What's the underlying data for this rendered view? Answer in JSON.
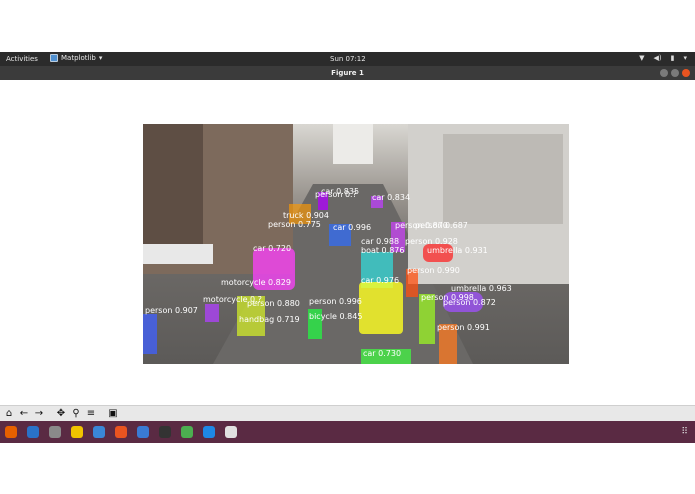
{
  "topbar": {
    "activities": "Activities",
    "app_name": "Matplotlib",
    "app_arrow": "▾",
    "clock": "Sun 07:12",
    "tray_icons": [
      "network-icon",
      "volume-icon",
      "battery-icon",
      "system-menu-icon"
    ]
  },
  "window": {
    "title": "Figure 1"
  },
  "detections": [
    {
      "label": "car 0.835",
      "color": "#9b30ff"
    },
    {
      "label": "person 0.?",
      "color": "#b000ff"
    },
    {
      "label": "car 0.834",
      "color": "#c040ff"
    },
    {
      "label": "truck 0.904",
      "color": "#ff9a00"
    },
    {
      "label": "person 0.775",
      "color": "#ffd000"
    },
    {
      "label": "car 0.996",
      "color": "#2f6cff"
    },
    {
      "label": "person 0.870",
      "color": "#c080ff"
    },
    {
      "label": "person 0.687",
      "color": "#d040ff"
    },
    {
      "label": "car 0.720",
      "color": "#ff40ff"
    },
    {
      "label": "car 0.988",
      "color": "#30e0e0"
    },
    {
      "label": "person 0.928",
      "color": "#ff2060"
    },
    {
      "label": "boat 0.876",
      "color": "#20d0d0"
    },
    {
      "label": "umbrella 0.931",
      "color": "#ff1a1a"
    },
    {
      "label": "person 0.990",
      "color": "#ff5010"
    },
    {
      "label": "motorcycle 0.829",
      "color": "#e0ff20"
    },
    {
      "label": "car 0.976",
      "color": "#ffff20"
    },
    {
      "label": "umbrella 0.963",
      "color": "#a050ff"
    },
    {
      "label": "motorcycle 0.?",
      "color": "#b040ff"
    },
    {
      "label": "person 0.880",
      "color": "#ff9020"
    },
    {
      "label": "person 0.996",
      "color": "#ff8010"
    },
    {
      "label": "person 0.998",
      "color": "#a0ff20"
    },
    {
      "label": "person 0.872",
      "color": "#20ff80"
    },
    {
      "label": "person 0.907",
      "color": "#4060ff"
    },
    {
      "label": "bicycle 0.845",
      "color": "#20ff40"
    },
    {
      "label": "handbag 0.719",
      "color": "#40ff90"
    },
    {
      "label": "person 0.991",
      "color": "#ff7a20"
    },
    {
      "label": "car 0.730",
      "color": "#40ff40"
    }
  ],
  "toolbar": {
    "buttons": [
      {
        "name": "home-icon",
        "glyph": "⌂"
      },
      {
        "name": "back-icon",
        "glyph": "←"
      },
      {
        "name": "forward-icon",
        "glyph": "→"
      },
      {
        "name": "pan-icon",
        "glyph": "✥"
      },
      {
        "name": "zoom-icon",
        "glyph": "⚲"
      },
      {
        "name": "configure-subplots-icon",
        "glyph": "≡"
      },
      {
        "name": "save-icon",
        "glyph": "▣"
      }
    ]
  },
  "taskbar": {
    "icons": [
      {
        "name": "firefox-icon",
        "color": "#e66000"
      },
      {
        "name": "thunderbird-icon",
        "color": "#2a72c8"
      },
      {
        "name": "files-icon",
        "color": "#8a8a8a"
      },
      {
        "name": "rhythmbox-icon",
        "color": "#f0c400"
      },
      {
        "name": "libreoffice-writer-icon",
        "color": "#3a87d6"
      },
      {
        "name": "software-center-icon",
        "color": "#e95420"
      },
      {
        "name": "help-icon",
        "color": "#3a7bd5"
      },
      {
        "name": "terminal-icon",
        "color": "#333333"
      },
      {
        "name": "chrome-icon",
        "color": "#4caf50"
      },
      {
        "name": "vscode-icon",
        "color": "#1e88e5"
      },
      {
        "name": "matplotlib-figure-icon",
        "color": "#e0e0e0"
      }
    ],
    "apps_glyph": "⠿"
  }
}
